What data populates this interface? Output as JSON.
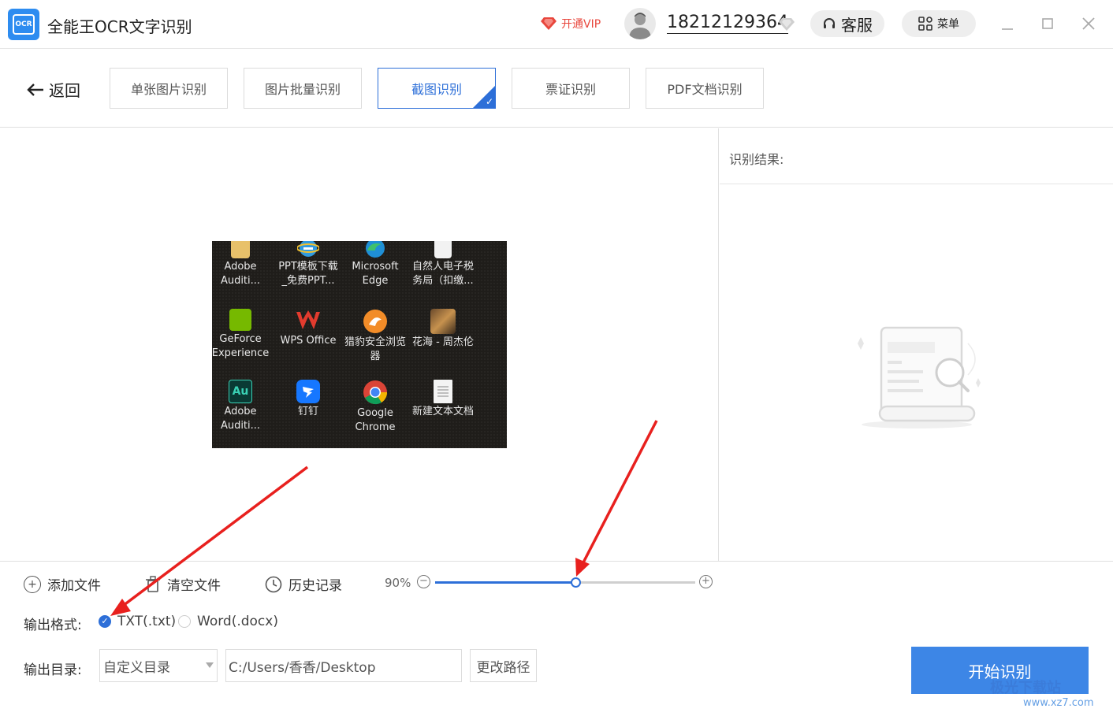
{
  "titlebar": {
    "logo_text": "OCR",
    "app_title": "全能王OCR文字识别",
    "vip_label": "开通VIP",
    "phone": "18212129364",
    "service_label": "客服",
    "menu_label": "菜单"
  },
  "nav": {
    "back_label": "返回",
    "tabs": [
      {
        "label": "单张图片识别"
      },
      {
        "label": "图片批量识别"
      },
      {
        "label": "截图识别"
      },
      {
        "label": "票证识别"
      },
      {
        "label": "PDF文档识别"
      }
    ],
    "active_tab": "截图识别"
  },
  "result": {
    "label": "识别结果:"
  },
  "preview": {
    "icons": [
      {
        "label": "Adobe\nAuditi...",
        "icon": "folder-icon"
      },
      {
        "label": "PPT模板下载\n_免费PPT...",
        "icon": "ie-icon"
      },
      {
        "label": "Microsoft\nEdge",
        "icon": "edge-icon"
      },
      {
        "label": "自然人电子税\n务局（扣缴...",
        "icon": "document-icon"
      },
      {
        "label": "GeForce\nExperience",
        "icon": "nvidia-icon"
      },
      {
        "label": "WPS Office",
        "icon": "wps-icon"
      },
      {
        "label": "猎豹安全浏览\n器",
        "icon": "liebao-icon"
      },
      {
        "label": "花海 - 周杰伦",
        "icon": "music-icon"
      },
      {
        "label": "Adobe\nAuditi...",
        "icon": "audition-icon"
      },
      {
        "label": "钉钉",
        "icon": "dingtalk-icon"
      },
      {
        "label": "Google\nChrome",
        "icon": "chrome-icon"
      },
      {
        "label": "新建文本文档",
        "icon": "text-file-icon"
      }
    ]
  },
  "toolbar": {
    "add_file": "添加文件",
    "clear_file": "清空文件",
    "history": "历史记录",
    "zoom_label": "90%",
    "zoom_fraction": 0.54
  },
  "output": {
    "format_label": "输出格式:",
    "formats": [
      {
        "label": "TXT(.txt)",
        "checked": true
      },
      {
        "label": "Word(.docx)",
        "checked": false
      }
    ],
    "dir_label": "输出目录:",
    "dir_select": "自定义目录",
    "dir_path": "C:/Users/香香/Desktop",
    "change_path_label": "更改路径",
    "start_label": "开始识别"
  },
  "watermark": {
    "text": "极光下载站",
    "url": "www.xz7.com"
  },
  "colors": {
    "accent": "#2d6fd8",
    "start_button": "#3d86e6",
    "vip_red": "#e8463c",
    "annotation_arrow": "#e8201e"
  }
}
